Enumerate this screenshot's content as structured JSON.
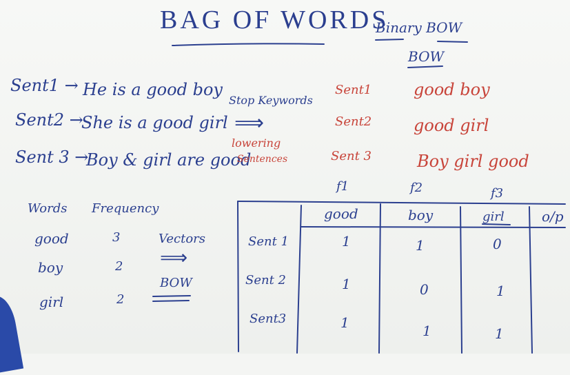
{
  "title": "BAG OF WORDS",
  "top_right": {
    "binary": "Binary BOW",
    "bow": "BOW"
  },
  "sentences": [
    {
      "label": "Sent1 →",
      "text": "He is a good boy"
    },
    {
      "label": "Sent2 →",
      "text": "She is a good girl"
    },
    {
      "label": "Sent 3 →",
      "text": "Boy & girl are good"
    }
  ],
  "processing": {
    "stop": "Stop Keywords",
    "arrow": "⟹",
    "lower1": "lowering",
    "lower2": "Sentences"
  },
  "processed": [
    {
      "label": "Sent1",
      "text": "good boy"
    },
    {
      "label": "Sent2",
      "text": "good girl"
    },
    {
      "label": "Sent 3",
      "text": "Boy girl good"
    }
  ],
  "freq_table": {
    "headers": [
      "Words",
      "Frequency"
    ],
    "rows": [
      [
        "good",
        "3"
      ],
      [
        "boy",
        "2"
      ],
      [
        "girl",
        "2"
      ]
    ]
  },
  "vectors": {
    "label": "Vectors",
    "arrow": "⟹",
    "bow": "BOW"
  },
  "matrix": {
    "feature_labels": [
      "f1",
      "f2",
      "f3"
    ],
    "columns": [
      "good",
      "boy",
      "girl",
      "o/p"
    ],
    "rows": [
      {
        "label": "Sent 1",
        "values": [
          "1",
          "1",
          "0"
        ]
      },
      {
        "label": "Sent 2",
        "values": [
          "1",
          "0",
          "1"
        ]
      },
      {
        "label": "Sent3",
        "values": [
          "1",
          "1",
          "1"
        ]
      }
    ]
  },
  "colors": {
    "blue_ink": "#2b3f8f",
    "red_ink": "#c8443a",
    "board": "#f4f5f3"
  }
}
